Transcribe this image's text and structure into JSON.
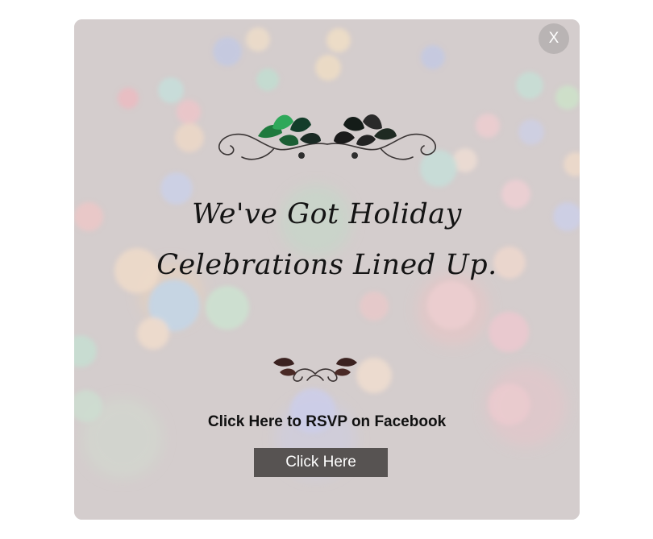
{
  "popup": {
    "close_label": "X",
    "headline_line1": "We've Got Holiday",
    "headline_line2": "Celebrations Lined Up.",
    "rsvp_text": "Click Here to RSVP on Facebook",
    "button_label": "Click Here"
  },
  "colors": {
    "background": "#d5cfcf",
    "button": "#575352",
    "close_button": "#b9b4b4",
    "text": "#141414"
  },
  "icons": {
    "close": "close-icon",
    "top_ornament": "floral-flourish-icon",
    "bottom_ornament": "flourish-divider-icon"
  }
}
